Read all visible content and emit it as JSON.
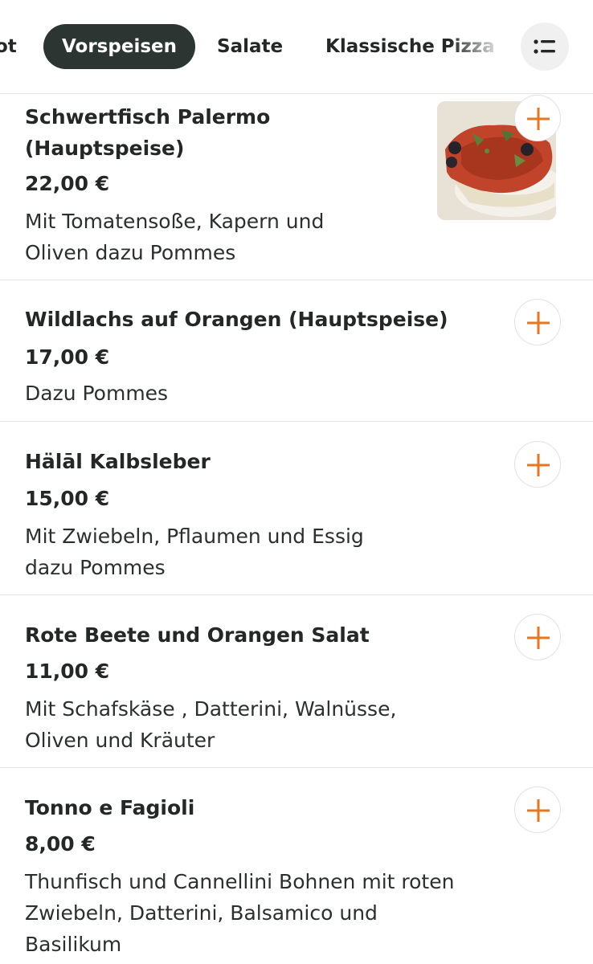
{
  "categories": {
    "partial_left": "ot",
    "active": "Vorspeisen",
    "salate": "Salate",
    "pizza": "Klassische Pizza"
  },
  "icons": {
    "filter": "list-filter-icon",
    "add": "plus-icon"
  },
  "accent_color": "#e8761f",
  "items": [
    {
      "name": "Schwertfisch Palermo (Hauptspeise)",
      "price": "22,00 €",
      "description": "Mit Tomatensoße, Kapern und Oliven dazu Pommes",
      "has_image": true
    },
    {
      "name": "Wildlachs auf Orangen (Hauptspeise)",
      "price": "17,00 €",
      "description": "Dazu Pommes"
    },
    {
      "name": "Hälāl Kalbsleber",
      "price": "15,00 €",
      "description": "Mit Zwiebeln, Pflaumen und Essig dazu Pommes"
    },
    {
      "name": "Rote Beete und Orangen Salat",
      "price": "11,00 €",
      "description": "Mit Schafskäse , Datterini, Walnüsse, Oliven und Kräuter"
    },
    {
      "name": "Tonno e Fagioli",
      "price": "8,00 €",
      "description": "Thunfisch und Cannellini Bohnen mit roten Zwiebeln, Datterini, Balsamico und Basilikum"
    }
  ]
}
